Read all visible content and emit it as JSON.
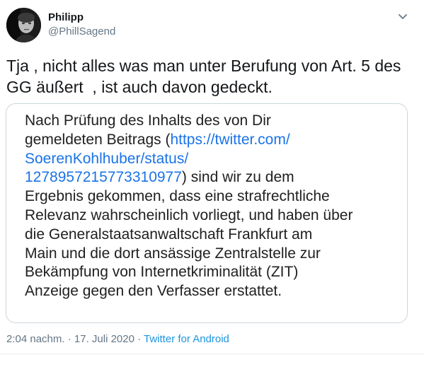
{
  "author": {
    "display_name": "Philipp",
    "handle": "@PhillSagend"
  },
  "tweet": {
    "text": "Tja , nicht alles was man unter Berufung von Art. 5 des\nGG äußert  , ist auch davon gedeckt."
  },
  "quote": {
    "line1": "Nach Prüfung des Inhalts des von Dir",
    "line2_pre": "gemeldeten Beitrags (",
    "line2_link": "https://twitter.com/",
    "line3_link": "SoerenKohlhuber/status/",
    "line4_link": "1278957215773310977",
    "line4_post": ") sind wir zu dem",
    "line5": "Ergebnis gekommen, dass eine strafrechtliche",
    "line6": "Relevanz wahrscheinlich vorliegt, und haben über",
    "line7": "die Generalstaatsanwaltschaft Frankfurt am",
    "line8": "Main und die dort ansässige Zentralstelle zur",
    "line9": "Bekämpfung von Internetkriminalität (ZIT)",
    "line10": "Anzeige gegen den Verfasser erstattet."
  },
  "meta": {
    "timestamp": "2:04 nachm. · 17. Juli 2020",
    "separator": " · ",
    "source": "Twitter for Android"
  },
  "colors": {
    "link": "#1a73e8",
    "source": "#1b95e0",
    "muted": "#657786",
    "border": "#ccd6dd"
  },
  "icons": {
    "caret": "chevron-down-icon",
    "avatar": "avatar"
  }
}
